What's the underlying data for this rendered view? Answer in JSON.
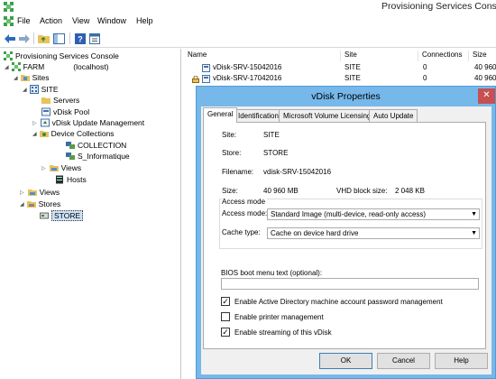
{
  "window": {
    "title": "Provisioning Services Conso"
  },
  "menu": [
    "File",
    "Action",
    "View",
    "Window",
    "Help"
  ],
  "colors": {
    "accent": "#76b8ea",
    "selection": "#cde3f7",
    "close": "#c75050"
  },
  "toolbar": {
    "icons": [
      "back-arrow-icon",
      "forward-arrow-icon",
      "folder-up-icon",
      "show-hide-tree-icon",
      "help-icon",
      "properties-icon"
    ]
  },
  "tree": {
    "root": "Provisioning Services Console",
    "farm": "FARM",
    "farm_host": "(localhost)",
    "sites": "Sites",
    "site": "SITE",
    "servers": "Servers",
    "vdisk_pool": "vDisk Pool",
    "vdisk_update": "vDisk Update Management",
    "device_collections": "Device Collections",
    "collection": "COLLECTION",
    "s_informatique": "S_Informatique",
    "views_site": "Views",
    "hosts": "Hosts",
    "views": "Views",
    "stores": "Stores",
    "store": "STORE"
  },
  "list": {
    "columns": [
      "Name",
      "Site",
      "Connections",
      "Size"
    ],
    "rows": [
      {
        "name": "vDisk-SRV-15042016",
        "site": "SITE",
        "connections": "0",
        "size": "40 960"
      },
      {
        "name": "vDisk-SRV-17042016",
        "site": "SITE",
        "connections": "0",
        "size": "40 960"
      }
    ]
  },
  "dialog": {
    "title": "vDisk Properties",
    "close": "✕",
    "tabs": [
      "General",
      "Identification",
      "Microsoft Volume Licensing",
      "Auto Update"
    ],
    "site_label": "Site:",
    "site_value": "SITE",
    "store_label": "Store:",
    "store_value": "STORE",
    "filename_label": "Filename:",
    "filename_value": "vdisk-SRV-15042016",
    "size_label": "Size:",
    "size_value": "40 960 MB",
    "block_label": "VHD block size:",
    "block_value": "2 048 KB",
    "access_group": "Access mode",
    "access_label": "Access mode:",
    "access_value": "Standard Image (multi-device, read-only access)",
    "cache_label": "Cache type:",
    "cache_value": "Cache on device hard drive",
    "bios_label": "BIOS boot menu text (optional):",
    "bios_value": "",
    "chk_ad_label": "Enable Active Directory machine account password management",
    "chk_ad": true,
    "chk_printer_label": "Enable printer management",
    "chk_printer": false,
    "chk_stream_label": "Enable streaming of this vDisk",
    "chk_stream": true,
    "ok": "OK",
    "cancel": "Cancel",
    "help": "Help"
  }
}
